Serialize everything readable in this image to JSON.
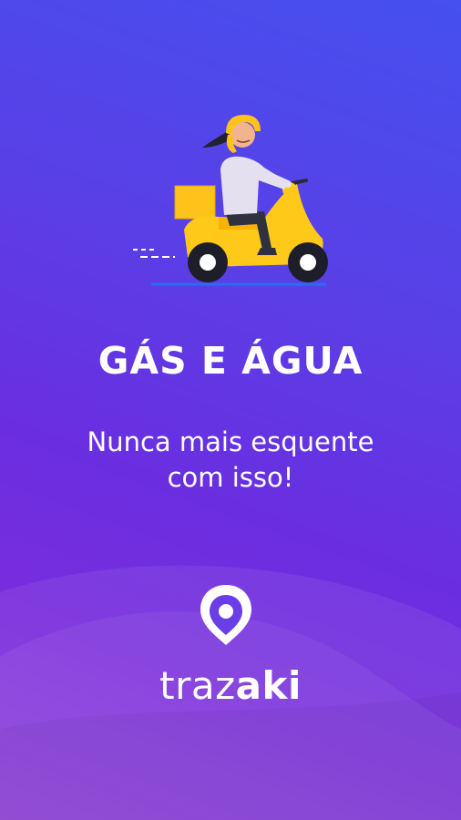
{
  "splash": {
    "headline": "GÁS E ÁGUA",
    "subtitle_line1": "Nunca mais esquente",
    "subtitle_line2": "com isso!"
  },
  "brand": {
    "name_light": "traz",
    "name_bold": "aki"
  },
  "colors": {
    "background_top": "#4550ee",
    "background_bottom": "#8a3ad8",
    "scooter_yellow": "#ffc91a",
    "helmet_yellow": "#ffc21a",
    "text": "#ffffff"
  },
  "icons": {
    "illustration": "delivery-scooter-rider",
    "logo": "location-pin-logo"
  }
}
